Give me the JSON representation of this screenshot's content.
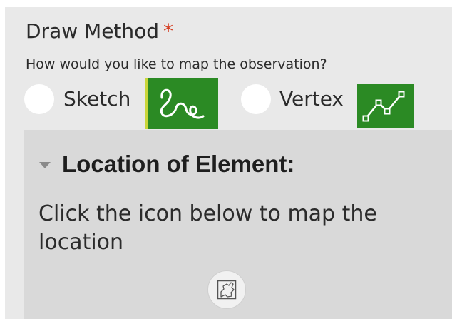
{
  "form": {
    "field": {
      "title": "Draw Method",
      "required_marker": "*",
      "description": "How would you like to map the observation?",
      "options": [
        {
          "label": "Sketch",
          "icon": "freehand-sketch-icon",
          "selected": false
        },
        {
          "label": "Vertex",
          "icon": "vertex-polyline-icon",
          "selected": false
        }
      ]
    },
    "group": {
      "title": "Location of Element:",
      "collapse_icon": "caret-down-icon",
      "instruction": "Click the icon below to map the location",
      "map_button_icon": "map-draw-icon"
    }
  },
  "colors": {
    "accent_green": "#2b8a24",
    "required_red": "#d43c1f",
    "panel_bg": "#e9e9e9",
    "group_bg": "#d9d9d9"
  }
}
